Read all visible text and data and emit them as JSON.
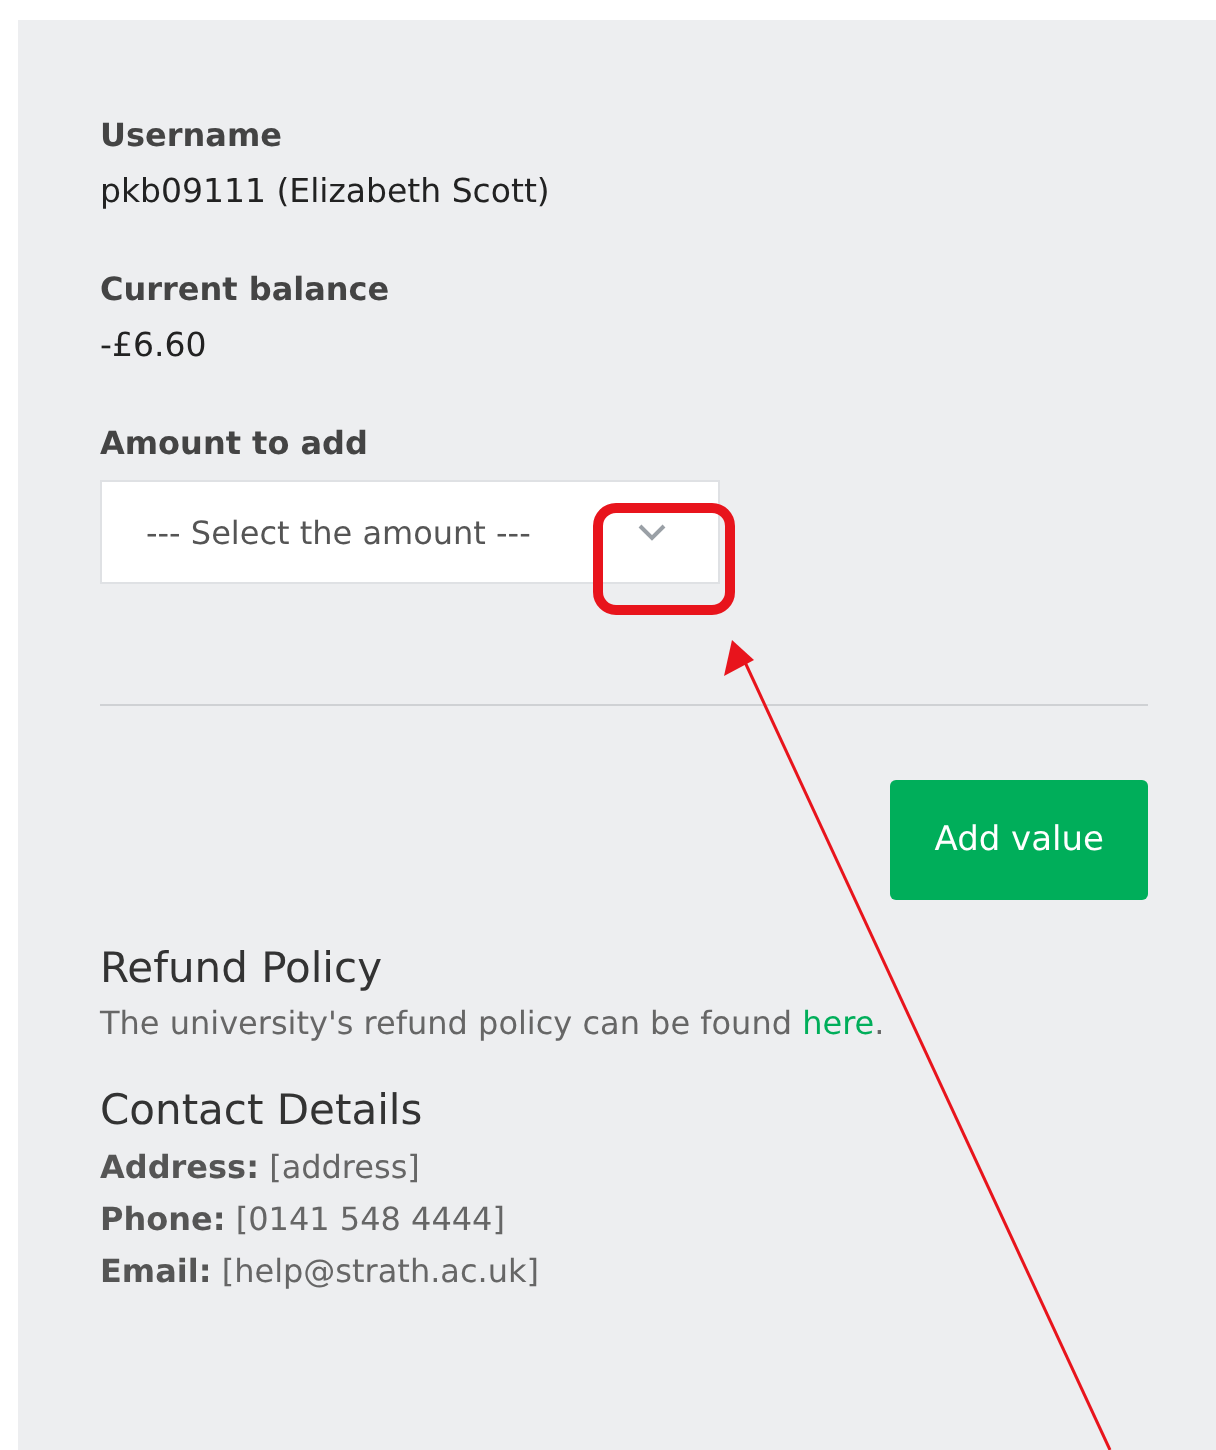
{
  "account": {
    "fields": [
      {
        "label": "Username",
        "value": "pkb09111 (Elizabeth Scott)"
      },
      {
        "label": "Current balance",
        "value": "-£6.60"
      }
    ]
  },
  "amount": {
    "label": "Amount to add",
    "placeholder": "--- Select the amount ---"
  },
  "button": "Add value",
  "refund": {
    "heading": "Refund Policy",
    "text_before": "The university's refund policy can be found ",
    "link": "here",
    "text_after": "."
  },
  "contact": {
    "heading": "Contact Details",
    "lines": [
      "**Address:** [address]",
      "**Phone:** [0141 548 4444]",
      "**Email:** [help@strath.ac.uk]"
    ]
  }
}
